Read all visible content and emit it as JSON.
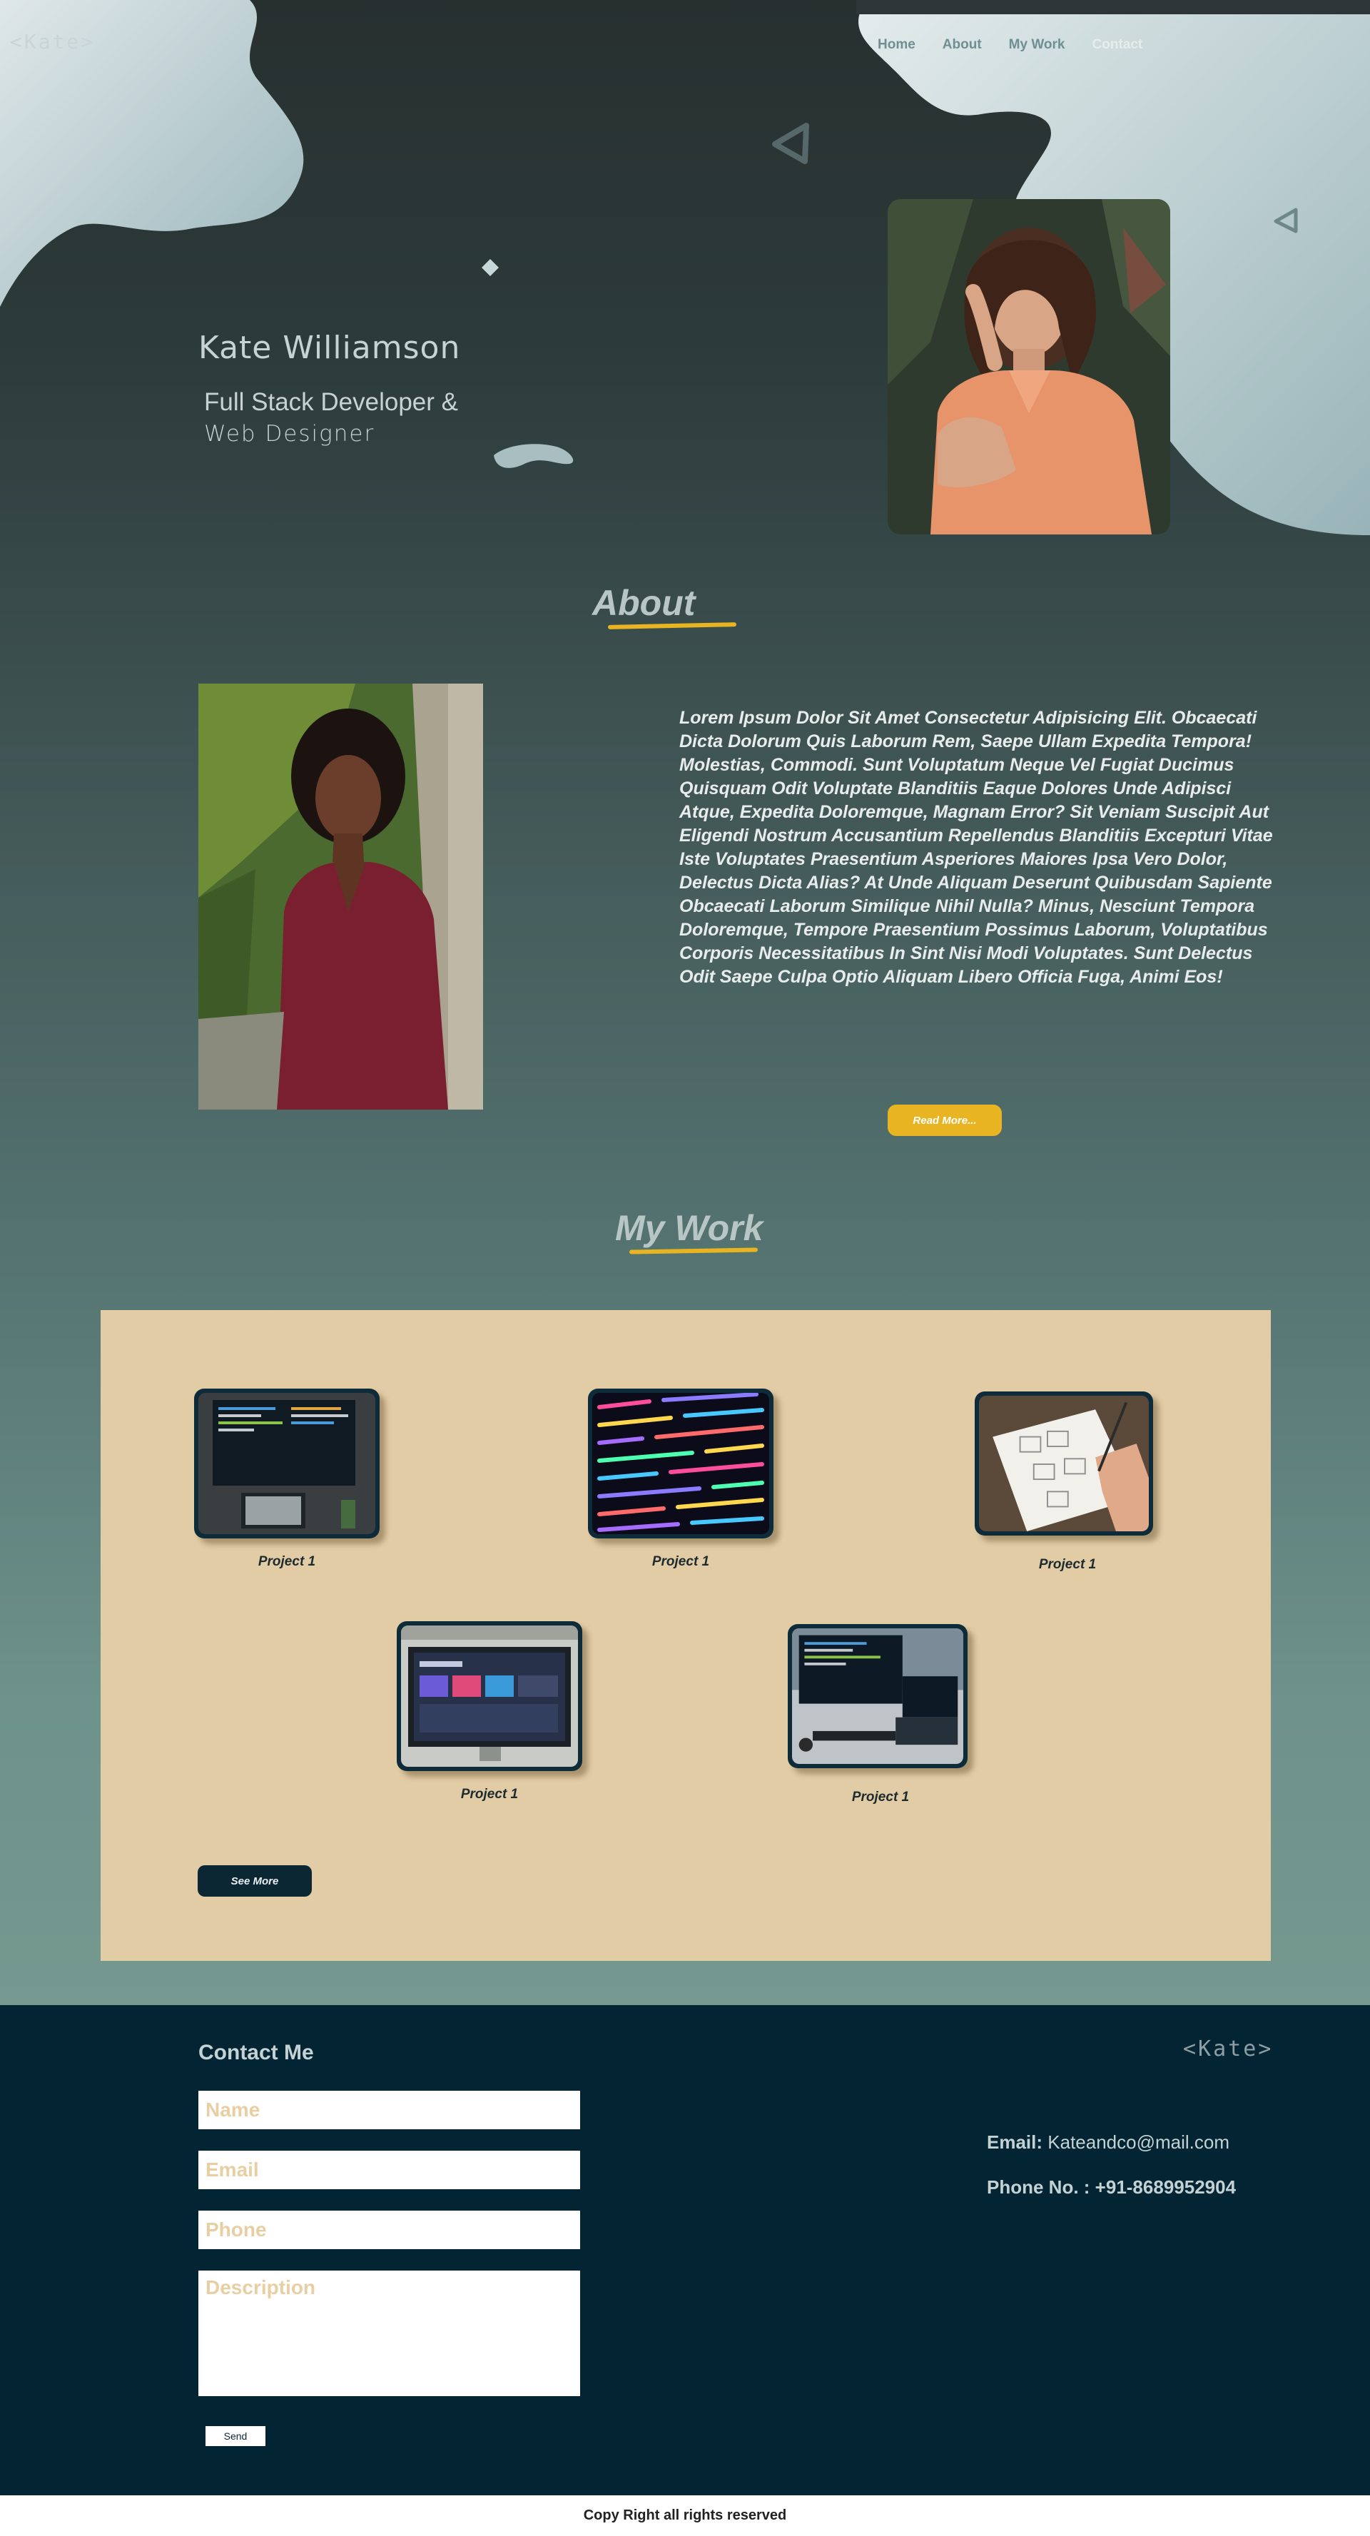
{
  "header": {
    "logo": "<Kate>",
    "nav": [
      {
        "label": "Home"
      },
      {
        "label": "About"
      },
      {
        "label": "My Work"
      },
      {
        "label": "Contact"
      }
    ]
  },
  "hero": {
    "name": "Kate Williamson",
    "role_line1": "Full Stack Developer &",
    "role_line2": "Web Designer"
  },
  "about": {
    "title": "About",
    "paragraph": "Lorem Ipsum Dolor Sit Amet Consectetur Adipisicing Elit. Obcaecati Dicta Dolorum Quis Laborum Rem, Saepe Ullam Expedita Tempora! Molestias, Commodi. Sunt Voluptatum Neque Vel Fugiat Ducimus Quisquam Odit Voluptate Blanditiis Eaque Dolores Unde Adipisci Atque, Expedita Doloremque, Magnam Error? Sit Veniam Suscipit Aut Eligendi Nostrum Accusantium Repellendus Blanditiis Excepturi Vitae Iste Voluptates Praesentium Asperiores Maiores Ipsa Vero Dolor, Delectus Dicta Alias? At Unde Aliquam Deserunt Quibusdam Sapiente Obcaecati Laborum Similique Nihil Nulla? Minus, Nesciunt Tempora Doloremque, Tempore Praesentium Possimus Laborum, Voluptatibus Corporis Necessitatibus In Sint Nisi Modi Voluptates. Sunt Delectus Odit Saepe Culpa Optio Aliquam Libero Officia Fuga, Animi Eos!",
    "read_more": "Read More..."
  },
  "work": {
    "title": "My Work",
    "projects": [
      {
        "label": "Project 1"
      },
      {
        "label": "Project 1"
      },
      {
        "label": "Project 1"
      },
      {
        "label": "Project 1"
      },
      {
        "label": "Project 1"
      }
    ],
    "see_more": "See More"
  },
  "contact": {
    "title": "Contact Me",
    "logo": "<Kate>",
    "name_placeholder": "Name",
    "email_placeholder": "Email",
    "phone_placeholder": "Phone",
    "description_placeholder": "Description",
    "send": "Send",
    "email_label": "Email:",
    "email_value": "Kateandco@mail.com",
    "phone_label": "Phone No. :",
    "phone_value": "+91-8689952904"
  },
  "footer": {
    "text": "Copy Right all rights reserved"
  },
  "colors": {
    "accent": "#e9b421",
    "contact_bg": "#032433",
    "work_panel": "#e2cca5"
  }
}
